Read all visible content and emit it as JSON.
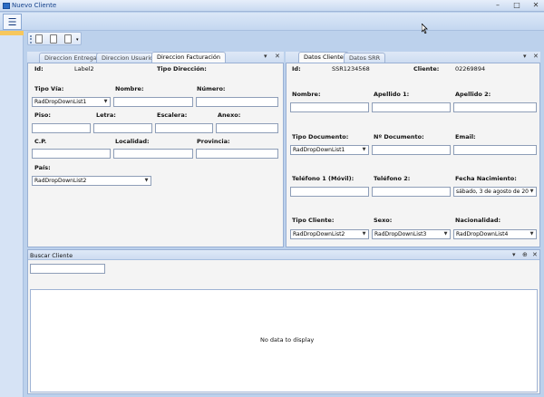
{
  "window": {
    "title": "Nuevo Cliente",
    "controls": [
      "–",
      "□",
      "✕"
    ]
  },
  "menu": {
    "icon": "hamburger-icon"
  },
  "toolbar": {
    "icons": [
      "new-document-icon",
      "new-document-icon",
      "new-document-icon",
      "overflow-icon"
    ]
  },
  "left_panel": {
    "tabs": [
      {
        "label": "Direccion Entrega"
      },
      {
        "label": "Direccion Usuario"
      },
      {
        "label": "Direccion Facturación"
      }
    ],
    "pin_glyph": "▾",
    "close_glyph": "✕",
    "fields": {
      "id_label": "Id:",
      "id_value": "Label2",
      "tipo_direccion_label": "Tipo Dirección:",
      "tipo_via_label": "Tipo Vía:",
      "tipo_via_value": "RadDropDownList1",
      "nombre_label": "Nombre:",
      "numero_label": "Número:",
      "piso_label": "Piso:",
      "letra_label": "Letra:",
      "escalera_label": "Escalera:",
      "anexo_label": "Anexo:",
      "cp_label": "C.P.",
      "localidad_label": "Localidad:",
      "provincia_label": "Provincia:",
      "pais_label": "País:",
      "pais_value": "RadDropDownList2"
    }
  },
  "right_panel": {
    "tabs": [
      {
        "label": "Datos Cliente"
      },
      {
        "label": "Datos SRR"
      }
    ],
    "pin_glyph": "▾",
    "close_glyph": "✕",
    "fields": {
      "id_label": "Id:",
      "id_value": "SSR1234568",
      "cliente_label": "Cliente:",
      "cliente_value": "02269894",
      "nombre_label": "Nombre:",
      "apellido1_label": "Apellido 1:",
      "apellido2_label": "Apellido 2:",
      "tipo_documento_label": "Tipo Documento:",
      "tipo_documento_value": "RadDropDownList1",
      "num_documento_label": "Nº Documento:",
      "email_label": "Email:",
      "telefono1_label": "Teléfono 1 (Móvil):",
      "telefono2_label": "Teléfono 2:",
      "fecha_nacimiento_label": "Fecha Nacimiento:",
      "fecha_nacimiento_value": "sábado, 3 de agosto de 20",
      "tipo_cliente_label": "Tipo Cliente:",
      "tipo_cliente_value": "RadDropDownList2",
      "sexo_label": "Sexo:",
      "sexo_value": "RadDropDownList3",
      "nacionalidad_label": "Nacionalidad:",
      "nacionalidad_value": "RadDropDownList4"
    }
  },
  "search_panel": {
    "title": "Buscar Cliente",
    "controls": [
      "▾",
      "⊕",
      "✕"
    ],
    "search_value": "",
    "empty_text": "No data to display"
  },
  "colors": {
    "accent": "#2b6cc4",
    "panel_border": "#99b0d4",
    "highlight": "#f7c75c"
  }
}
